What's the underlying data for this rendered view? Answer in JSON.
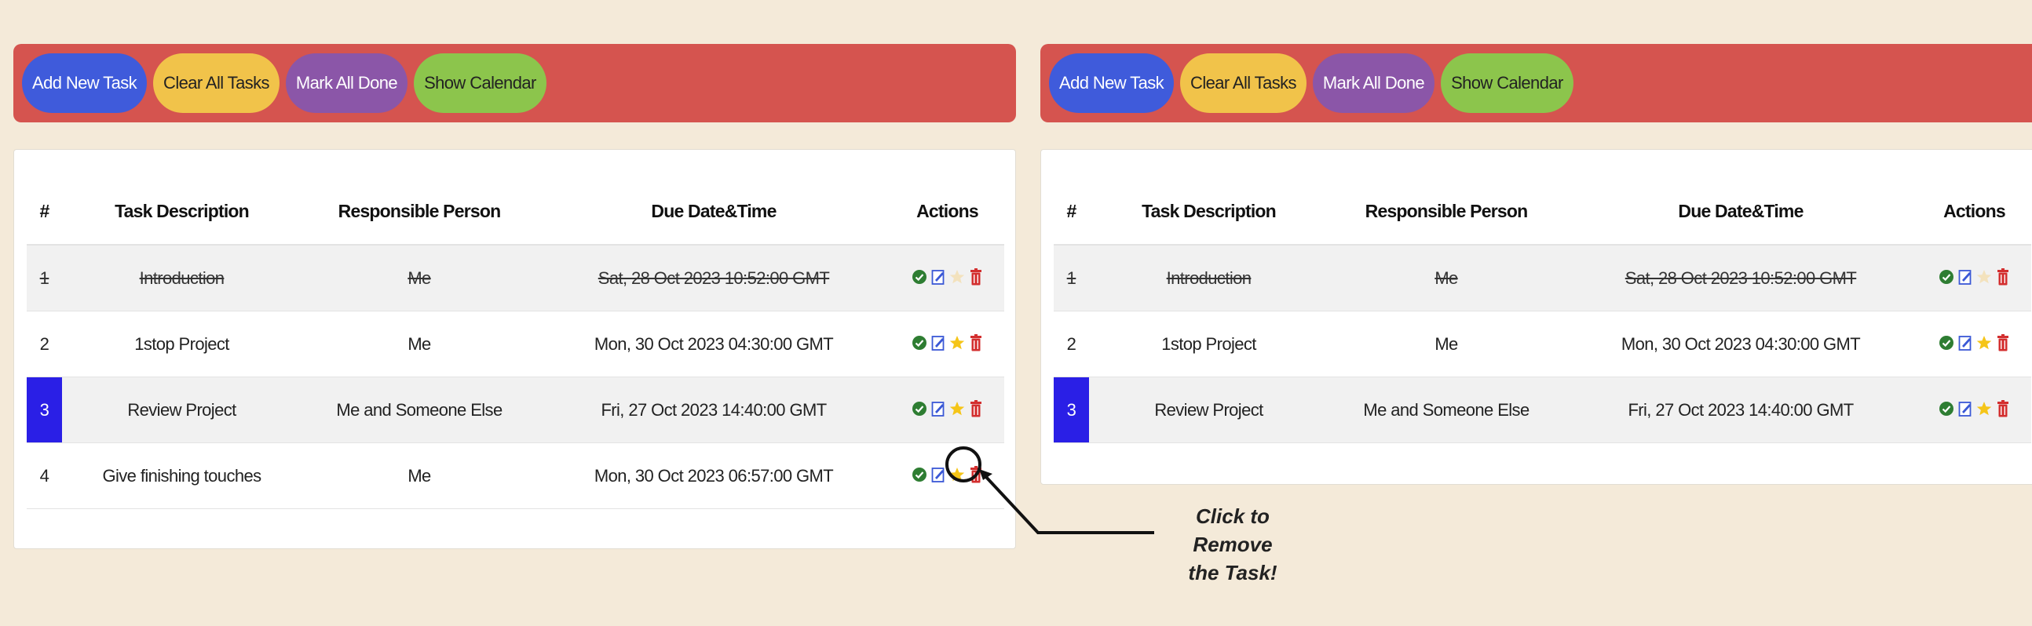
{
  "toolbar": {
    "add": "Add New Task",
    "clear": "Clear All Tasks",
    "mark_done": "Mark All Done",
    "calendar": "Show Calendar"
  },
  "table": {
    "headers": [
      "#",
      "Task Description",
      "Responsible Person",
      "Due Date&Time",
      "Actions"
    ]
  },
  "left_rows": [
    {
      "num": "1",
      "desc": "Introduction",
      "person": "Me",
      "due": "Sat, 28 Oct 2023 10:52:00 GMT",
      "done": true,
      "starred": false
    },
    {
      "num": "2",
      "desc": "1stop Project",
      "person": "Me",
      "due": "Mon, 30 Oct 2023 04:30:00 GMT",
      "done": false,
      "starred": true
    },
    {
      "num": "3",
      "desc": "Review Project",
      "person": "Me and Someone Else",
      "due": "Fri, 27 Oct 2023 14:40:00 GMT",
      "done": false,
      "starred": true,
      "highlighted": true
    },
    {
      "num": "4",
      "desc": "Give finishing touches",
      "person": "Me",
      "due": "Mon, 30 Oct 2023 06:57:00 GMT",
      "done": false,
      "starred": true
    }
  ],
  "right_rows": [
    {
      "num": "1",
      "desc": "Introduction",
      "person": "Me",
      "due": "Sat, 28 Oct 2023 10:52:00 GMT",
      "done": true,
      "starred": false
    },
    {
      "num": "2",
      "desc": "1stop Project",
      "person": "Me",
      "due": "Mon, 30 Oct 2023 04:30:00 GMT",
      "done": false,
      "starred": true
    },
    {
      "num": "3",
      "desc": "Review Project",
      "person": "Me and Someone Else",
      "due": "Fri, 27 Oct 2023 14:40:00 GMT",
      "done": false,
      "starred": true,
      "highlighted": true
    }
  ],
  "callout": {
    "line1": "Click to Remove",
    "line2": "the Task!"
  },
  "colors": {
    "background": "#f4ead9",
    "toolbar": "#d5544f",
    "add_button": "#3f5bdb",
    "clear_button": "#f1c34a",
    "mark_done_button": "#8b56a8",
    "calendar_button": "#8cc54c",
    "highlight_cell": "#2a1fe6"
  }
}
